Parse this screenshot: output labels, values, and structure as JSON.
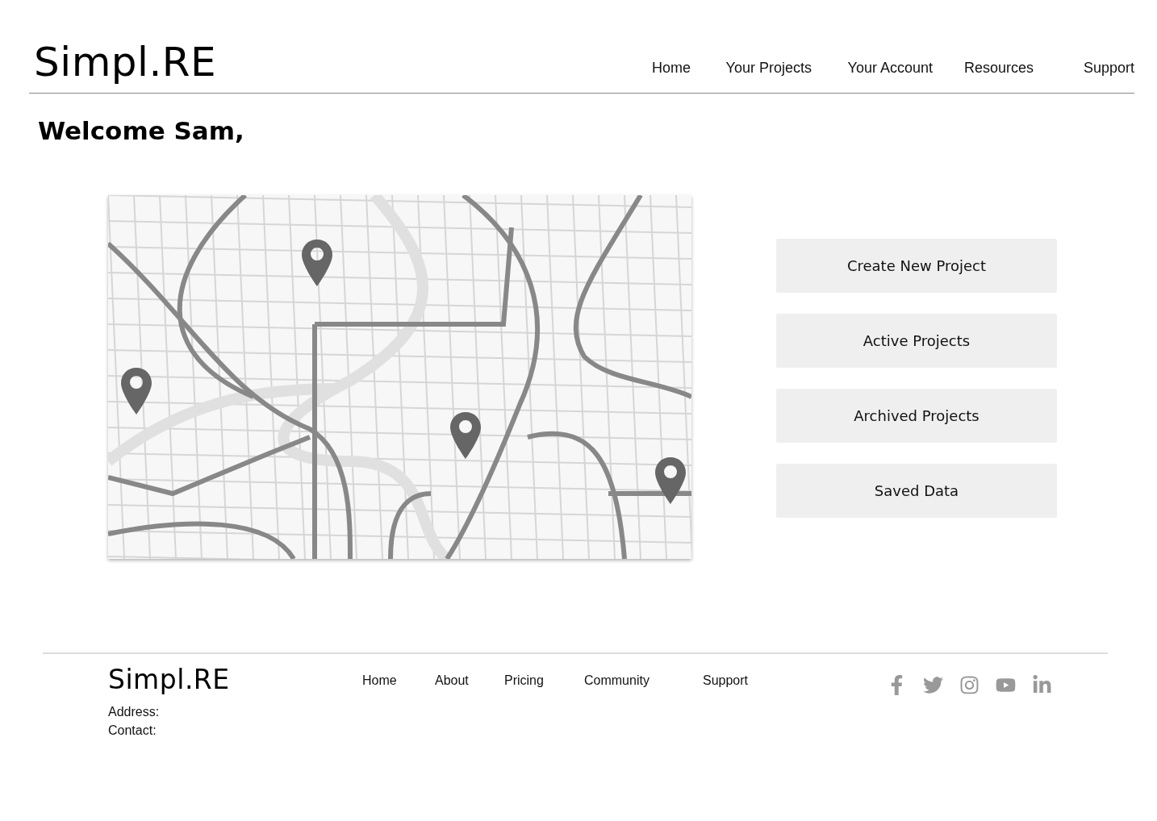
{
  "header": {
    "logo": "Simpl.RE",
    "nav": [
      "Home",
      "Your Projects",
      "Your Account",
      "Resources",
      "Support"
    ]
  },
  "greeting": "Welcome Sam,",
  "actions": [
    "Create New Project",
    "Active Projects",
    "Archived Projects",
    "Saved Data"
  ],
  "footer": {
    "logo": "Simpl.RE",
    "address_label": "Address:",
    "contact_label": "Contact:",
    "links": [
      "Home",
      "About",
      "Pricing",
      "Community",
      "Support"
    ]
  }
}
